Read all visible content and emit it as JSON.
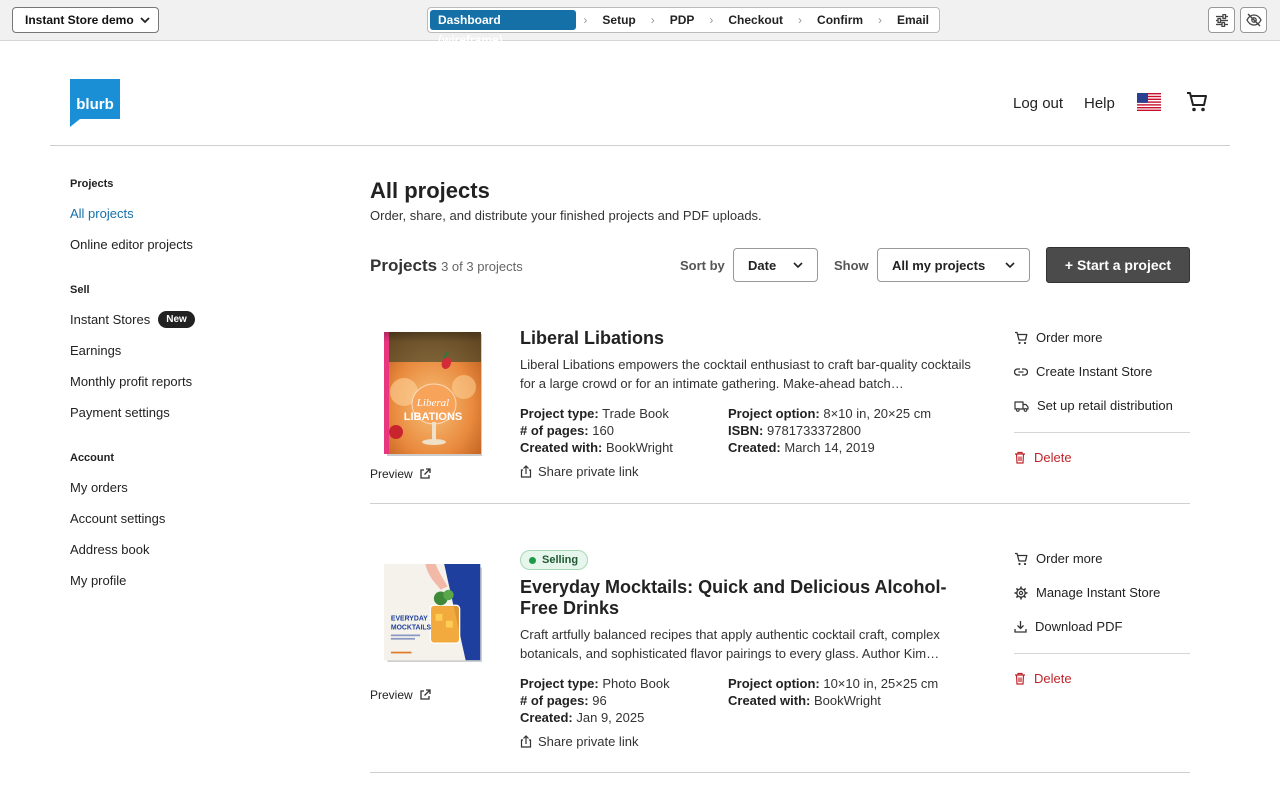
{
  "wireframe": {
    "demo_select": "Instant Store demo",
    "steps": [
      "Dashboard (wireframe)",
      "Setup",
      "PDP",
      "Checkout",
      "Confirm",
      "Email"
    ],
    "active_step": 0
  },
  "header": {
    "logo_text": "blurb",
    "logout": "Log out",
    "help": "Help"
  },
  "sidebar": {
    "sections": [
      {
        "heading": "Projects",
        "items": [
          {
            "label": "All projects",
            "active": true
          },
          {
            "label": "Online editor projects"
          }
        ]
      },
      {
        "heading": "Sell",
        "items": [
          {
            "label": "Instant Stores",
            "badge": "New"
          },
          {
            "label": "Earnings"
          },
          {
            "label": "Monthly profit reports"
          },
          {
            "label": "Payment settings"
          }
        ]
      },
      {
        "heading": "Account",
        "items": [
          {
            "label": "My orders"
          },
          {
            "label": "Account settings"
          },
          {
            "label": "Address book"
          },
          {
            "label": "My profile"
          }
        ]
      }
    ]
  },
  "main": {
    "title": "All projects",
    "subtitle": "Order, share, and distribute your finished projects and PDF uploads.",
    "projects_heading": "Projects",
    "projects_count": "3 of 3 projects",
    "sort_label": "Sort by",
    "sort_value": "Date",
    "show_label": "Show",
    "show_value": "All my projects",
    "start_button": "+ Start a project"
  },
  "projects": [
    {
      "title": "Liberal Libations",
      "cover_text": "Liberal LIBATIONS",
      "description": "Liberal Libations empowers the cocktail enthusiast to craft bar-quality cocktails for a large crowd or for an intimate gathering. Make-ahead batch…",
      "preview": "Preview",
      "meta_left": [
        {
          "k": "Project type:",
          "v": "Trade Book"
        },
        {
          "k": "# of pages:",
          "v": "160"
        },
        {
          "k": "Created with:",
          "v": "BookWright"
        }
      ],
      "meta_right": [
        {
          "k": "Project option:",
          "v": "8×10 in, 20×25 cm"
        },
        {
          "k": "ISBN:",
          "v": "9781733372800"
        },
        {
          "k": "Created:",
          "v": "March 14, 2019"
        }
      ],
      "share": "Share private link",
      "actions": [
        "Order more",
        "Create Instant Store",
        "Set up retail distribution"
      ],
      "delete": "Delete",
      "accent": "#e8367f"
    },
    {
      "title": "Everyday Mocktails: Quick and Delicious Alcohol-Free Drinks",
      "status": "Selling",
      "cover_text": "EVERYDAY MOCKTAILS",
      "description": "Craft artfully balanced recipes that apply authentic cocktail craft, complex botanicals, and sophisticated flavor pairings to every glass. Author Kim…",
      "preview": "Preview",
      "meta_left": [
        {
          "k": "Project type:",
          "v": "Photo Book"
        },
        {
          "k": "# of pages:",
          "v": "96"
        },
        {
          "k": "Created:",
          "v": "Jan 9, 2025"
        }
      ],
      "meta_right": [
        {
          "k": "Project option:",
          "v": "10×10 in, 25×25 cm"
        },
        {
          "k": "Created with:",
          "v": "BookWright"
        }
      ],
      "share": "Share private link",
      "actions": [
        "Order more",
        "Manage Instant Store",
        "Download PDF"
      ],
      "delete": "Delete",
      "accent": "#1f3f9e"
    }
  ]
}
